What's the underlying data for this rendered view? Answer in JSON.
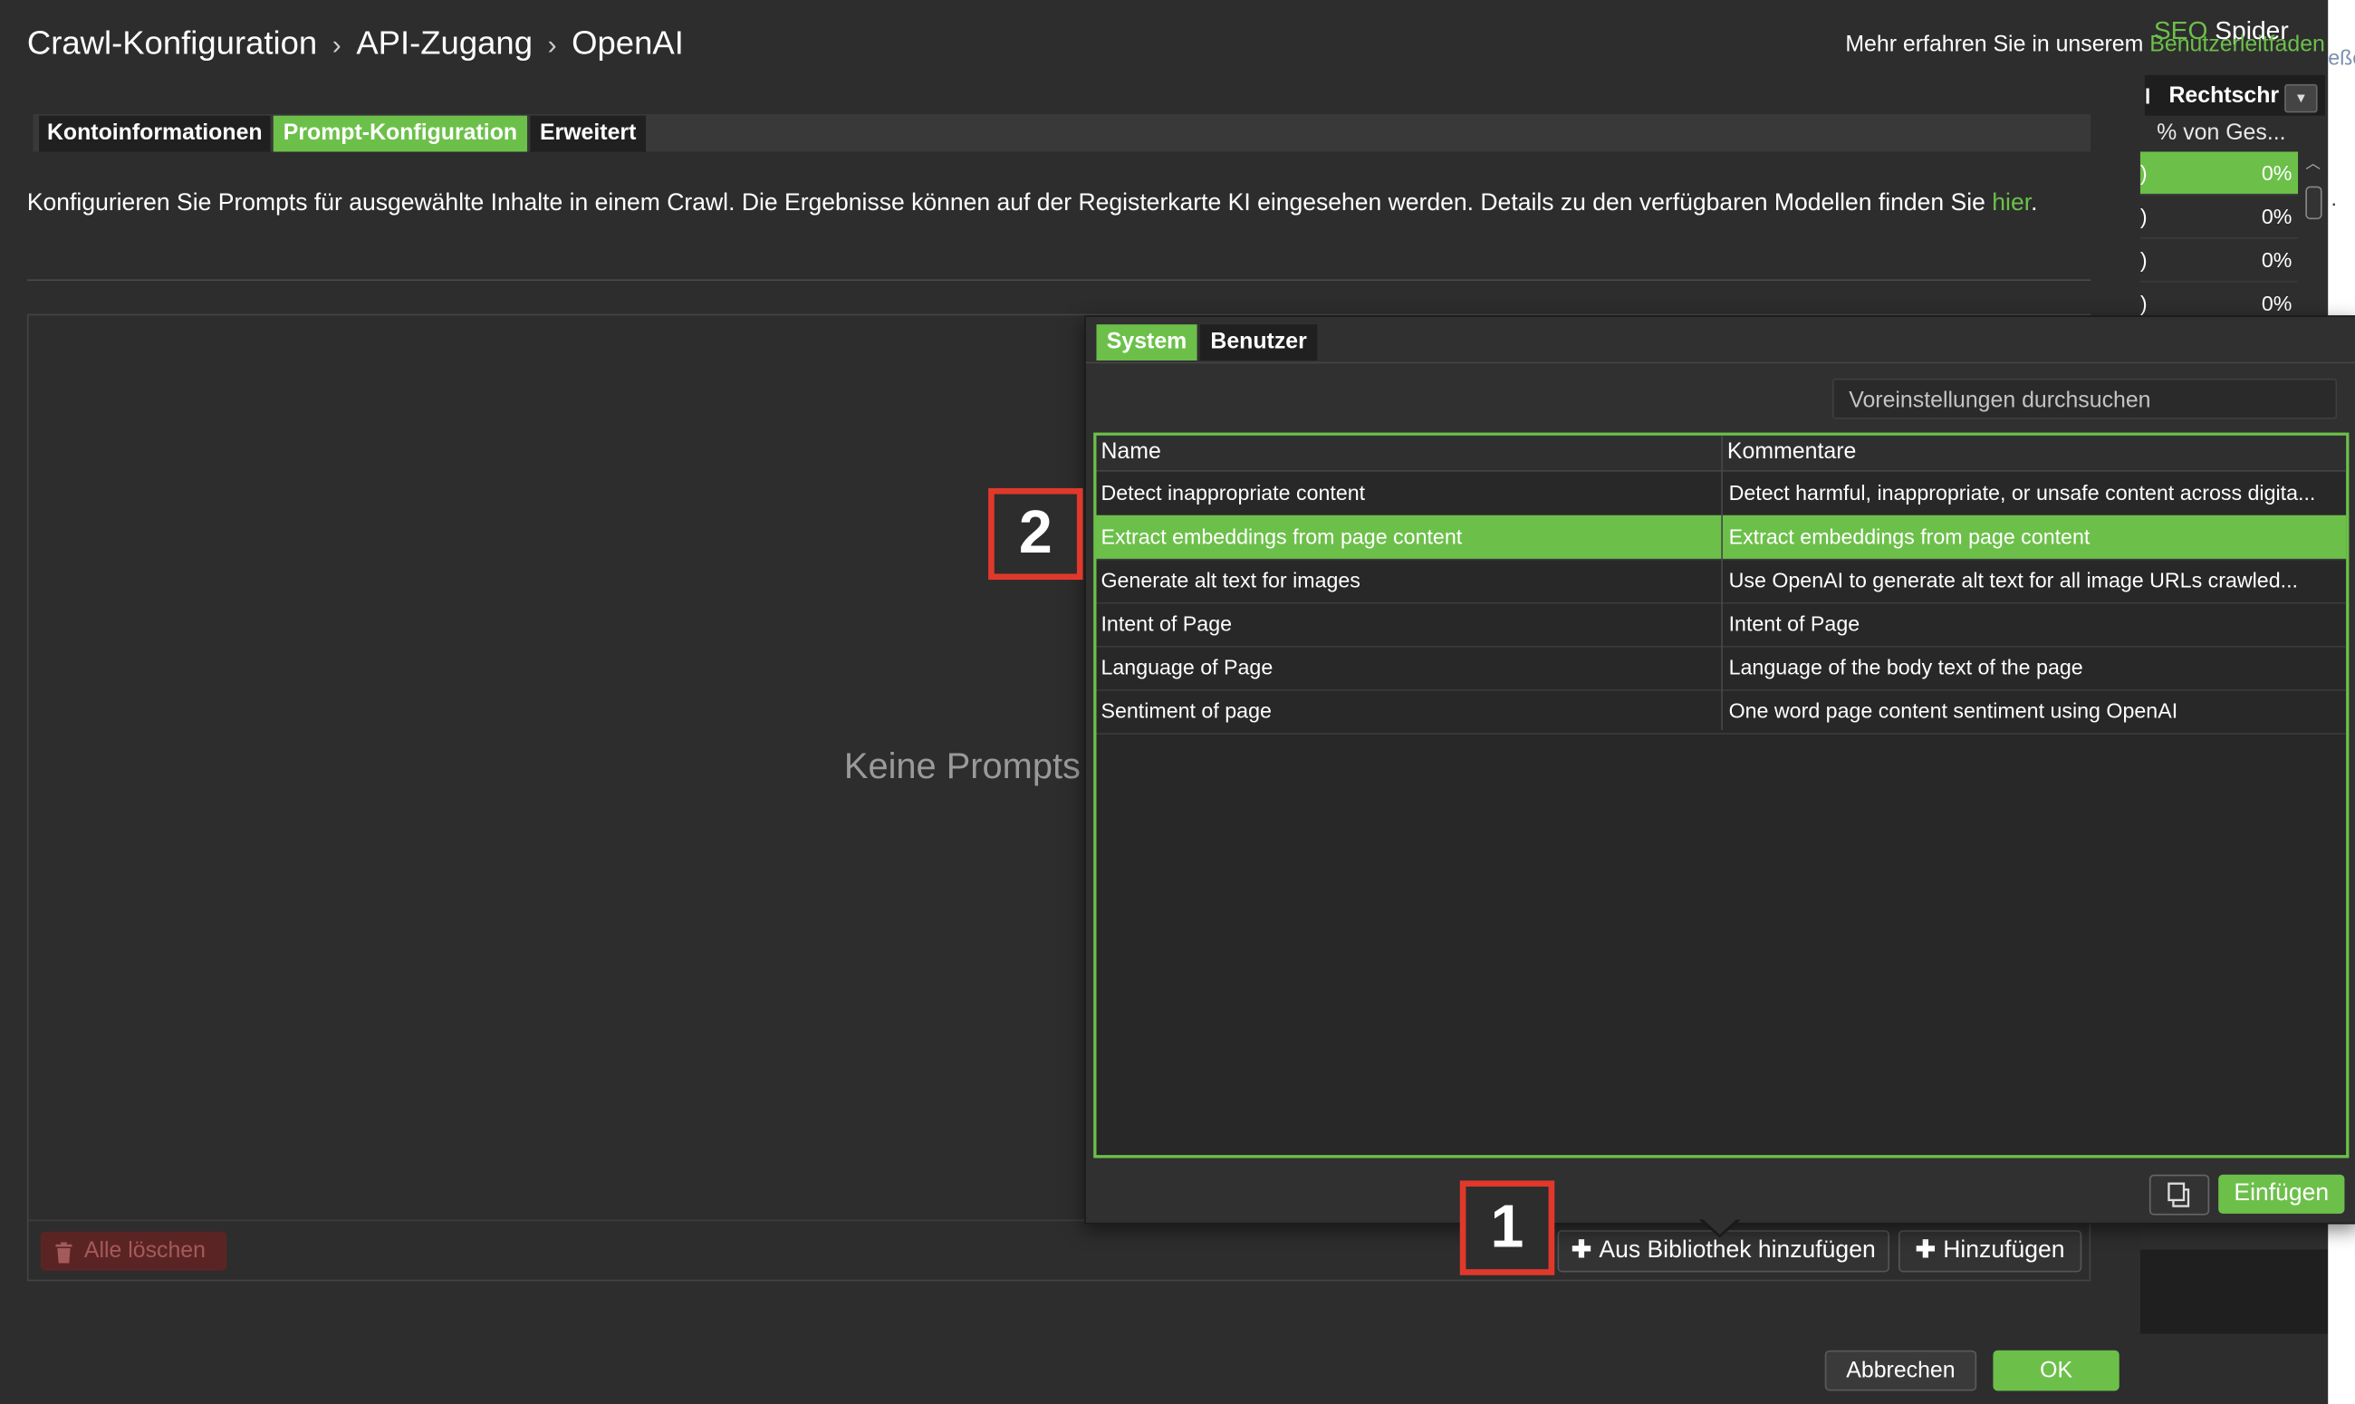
{
  "background_window": {
    "title_accent": "SEO",
    "title_rest": " Spider",
    "column_prefix": "l",
    "column_header": "Rechtschr",
    "column_subheader": "% von Ges...",
    "rows": [
      {
        "prefix": ")",
        "value": "0%"
      },
      {
        "prefix": ")",
        "value": "0%"
      },
      {
        "prefix": ")",
        "value": "0%"
      },
      {
        "prefix": ")",
        "value": "0%"
      }
    ],
    "edge_text": "eße",
    "edge_dot": "."
  },
  "dialog": {
    "breadcrumb": [
      "Crawl-Konfiguration",
      "API-Zugang",
      "OpenAI"
    ],
    "breadcrumb_separator": "›",
    "help_text": "Mehr erfahren Sie in unserem ",
    "help_link": "Benutzerleitfaden",
    "tabs": [
      "Kontoinformationen",
      "Prompt-Konfiguration",
      "Erweitert"
    ],
    "active_tab": "Prompt-Konfiguration",
    "description": "Konfigurieren Sie Prompts für ausgewählte Inhalte in einem Crawl. Die Ergebnisse können auf der Registerkarte KI eingesehen werden. Details zu den verfügbaren Modellen finden Sie ",
    "description_link": "hier",
    "description_end": ".",
    "empty_state": "Keine Prompts",
    "delete_all": "Alle löschen",
    "add_from_library": "Aus Bibliothek hinzufügen",
    "add": "Hinzufügen",
    "cancel": "Abbrechen",
    "ok": "OK"
  },
  "library_popup": {
    "tabs": [
      "System",
      "Benutzer"
    ],
    "active_tab": "System",
    "search_placeholder": "Voreinstellungen durchsuchen",
    "columns": [
      "Name",
      "Kommentare"
    ],
    "rows": [
      {
        "name": "Detect inappropriate content",
        "comment": "Detect harmful, inappropriate, or unsafe content across digita..."
      },
      {
        "name": "Extract embeddings from page content",
        "comment": "Extract embeddings from page content"
      },
      {
        "name": "Generate alt text for images",
        "comment": "Use OpenAI to generate alt text for all image URLs crawled..."
      },
      {
        "name": "Intent of Page",
        "comment": "Intent of Page"
      },
      {
        "name": "Language of Page",
        "comment": "Language of the body text of the page"
      },
      {
        "name": "Sentiment of page",
        "comment": "One word page content sentiment using OpenAI"
      }
    ],
    "selected_row": "Extract embeddings from page content",
    "insert": "Einfügen"
  },
  "annotations": [
    "1",
    "2"
  ],
  "colors": {
    "accent": "#6cc04a",
    "background": "#2d2d2d",
    "annotation_border": "#e0392b",
    "danger_bg": "#5b2424"
  },
  "icons": [
    "trash-icon",
    "plus-icon",
    "copy-icon",
    "dropdown-arrow-icon",
    "scroll-up-icon"
  ]
}
